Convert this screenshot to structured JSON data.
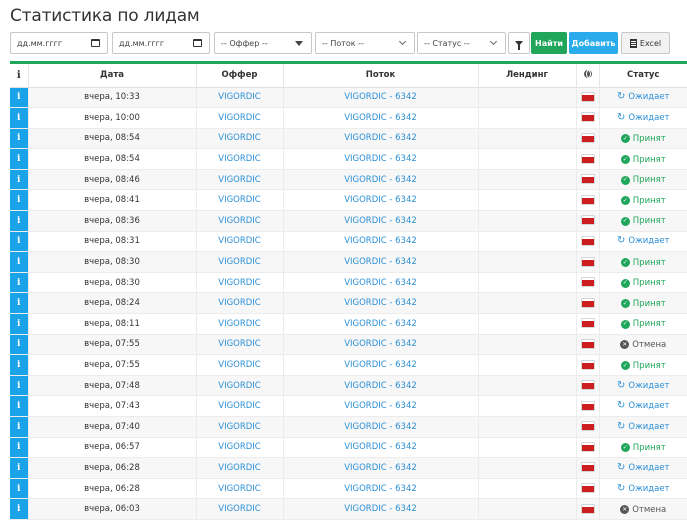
{
  "page": {
    "title": "Статистика по лидам"
  },
  "filters": {
    "date_from_placeholder": "дд.мм.гггг",
    "date_to_placeholder": "дд.мм.гггг",
    "offer_select": "-- Оффер --",
    "stream_select": "-- Поток --",
    "status_select": "-- Статус --",
    "find_label": "Найти",
    "add_label": "Добавить",
    "excel_label": "Excel"
  },
  "table": {
    "columns": {
      "info": "i",
      "date": "Дата",
      "offer": "Оффер",
      "stream": "Поток",
      "landing": "Лендинг",
      "geo_icon": "globe-icon",
      "status": "Статус"
    },
    "rows": [
      {
        "date": "вчера, 10:33",
        "offer": "VIGORDIC",
        "stream": "VIGORDIC - 6342",
        "landing": "",
        "status": "Ожидает",
        "kind": "wait"
      },
      {
        "date": "вчера, 10:00",
        "offer": "VIGORDIC",
        "stream": "VIGORDIC - 6342",
        "landing": "",
        "status": "Ожидает",
        "kind": "wait"
      },
      {
        "date": "вчера, 08:54",
        "offer": "VIGORDIC",
        "stream": "VIGORDIC - 6342",
        "landing": "",
        "status": "Принят",
        "kind": "ok"
      },
      {
        "date": "вчера, 08:54",
        "offer": "VIGORDIC",
        "stream": "VIGORDIC - 6342",
        "landing": "",
        "status": "Принят",
        "kind": "ok"
      },
      {
        "date": "вчера, 08:46",
        "offer": "VIGORDIC",
        "stream": "VIGORDIC - 6342",
        "landing": "",
        "status": "Принят",
        "kind": "ok"
      },
      {
        "date": "вчера, 08:41",
        "offer": "VIGORDIC",
        "stream": "VIGORDIC - 6342",
        "landing": "",
        "status": "Принят",
        "kind": "ok"
      },
      {
        "date": "вчера, 08:36",
        "offer": "VIGORDIC",
        "stream": "VIGORDIC - 6342",
        "landing": "",
        "status": "Принят",
        "kind": "ok"
      },
      {
        "date": "вчера, 08:31",
        "offer": "VIGORDIC",
        "stream": "VIGORDIC - 6342",
        "landing": "",
        "status": "Ожидает",
        "kind": "wait"
      },
      {
        "date": "вчера, 08:30",
        "offer": "VIGORDIC",
        "stream": "VIGORDIC - 6342",
        "landing": "",
        "status": "Принят",
        "kind": "ok"
      },
      {
        "date": "вчера, 08:30",
        "offer": "VIGORDIC",
        "stream": "VIGORDIC - 6342",
        "landing": "",
        "status": "Принят",
        "kind": "ok"
      },
      {
        "date": "вчера, 08:24",
        "offer": "VIGORDIC",
        "stream": "VIGORDIC - 6342",
        "landing": "",
        "status": "Принят",
        "kind": "ok"
      },
      {
        "date": "вчера, 08:11",
        "offer": "VIGORDIC",
        "stream": "VIGORDIC - 6342",
        "landing": "",
        "status": "Принят",
        "kind": "ok"
      },
      {
        "date": "вчера, 07:55",
        "offer": "VIGORDIC",
        "stream": "VIGORDIC - 6342",
        "landing": "",
        "status": "Отмена",
        "kind": "cancel"
      },
      {
        "date": "вчера, 07:55",
        "offer": "VIGORDIC",
        "stream": "VIGORDIC - 6342",
        "landing": "",
        "status": "Принят",
        "kind": "ok"
      },
      {
        "date": "вчера, 07:48",
        "offer": "VIGORDIC",
        "stream": "VIGORDIC - 6342",
        "landing": "",
        "status": "Ожидает",
        "kind": "wait"
      },
      {
        "date": "вчера, 07:43",
        "offer": "VIGORDIC",
        "stream": "VIGORDIC - 6342",
        "landing": "",
        "status": "Ожидает",
        "kind": "wait"
      },
      {
        "date": "вчера, 07:40",
        "offer": "VIGORDIC",
        "stream": "VIGORDIC - 6342",
        "landing": "",
        "status": "Ожидает",
        "kind": "wait"
      },
      {
        "date": "вчера, 06:57",
        "offer": "VIGORDIC",
        "stream": "VIGORDIC - 6342",
        "landing": "",
        "status": "Принят",
        "kind": "ok"
      },
      {
        "date": "вчера, 06:28",
        "offer": "VIGORDIC",
        "stream": "VIGORDIC - 6342",
        "landing": "",
        "status": "Ожидает",
        "kind": "wait"
      },
      {
        "date": "вчера, 06:28",
        "offer": "VIGORDIC",
        "stream": "VIGORDIC - 6342",
        "landing": "",
        "status": "Ожидает",
        "kind": "wait"
      },
      {
        "date": "вчера, 06:03",
        "offer": "VIGORDIC",
        "stream": "VIGORDIC - 6342",
        "landing": "",
        "status": "Отмена",
        "kind": "cancel"
      }
    ]
  },
  "colors": {
    "accent_green": "#1fa65a",
    "accent_blue": "#2aabeb",
    "info_blue": "#1aa3e8",
    "link_blue": "#2b8fd6"
  },
  "icons": {
    "date_picker": "calendar-icon",
    "filter": "funnel-icon",
    "excel": "file-icon",
    "row_info": "info-icon",
    "geo_flag": "flag-icon",
    "wait_status": "sync-icon",
    "ok_status": "check-icon",
    "cancel_status": "cross-icon"
  }
}
